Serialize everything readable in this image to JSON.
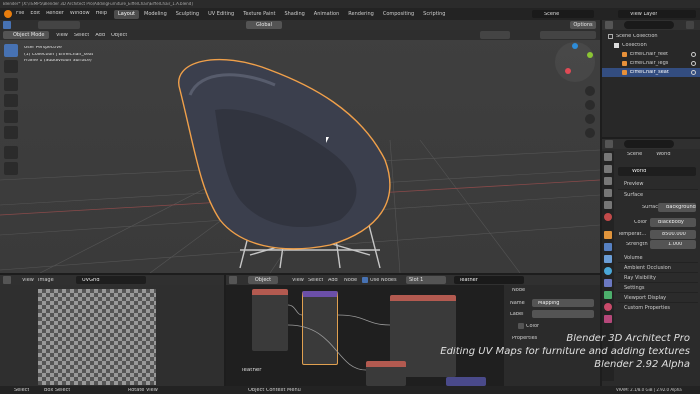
{
  "titlebar": {
    "title": "Blender* [X:\\TEMP5\\Blender 3D Architect Pro\\AddingFurniture_EiffelChair\\EiffelChair_1.A.blend]"
  },
  "menubar": {
    "menus": [
      "File",
      "Edit",
      "Render",
      "Window",
      "Help"
    ],
    "workspaces": [
      "Layout",
      "Modeling",
      "Sculpting",
      "UV Editing",
      "Texture Paint",
      "Shading",
      "Animation",
      "Rendering",
      "Compositing",
      "Scripting"
    ],
    "active_workspace": "Layout",
    "scene": "Scene",
    "view_layer": "View Layer"
  },
  "viewport": {
    "mode": "Object Mode",
    "menus": [
      "View",
      "Select",
      "Add",
      "Object"
    ],
    "transform": "Global",
    "options": "Options",
    "overlay_lines": [
      "User Perspective",
      "(1) Collection | EiffelChair_seat",
      "Frame 1 (Subdivision Surface)"
    ]
  },
  "outliner": {
    "root": "Scene Collection",
    "collection": "Collection",
    "items": [
      "EiffelChair_feet",
      "EiffelChair_legs",
      "EiffelChair_seat"
    ],
    "selected": "EiffelChair_seat"
  },
  "properties": {
    "context": "Scene",
    "tab": "World",
    "world_name": "World",
    "sections": [
      "Preview",
      "Surface",
      "Volume",
      "Ray Visibility",
      "Settings",
      "Custom Properties"
    ],
    "surface_label": "Surface",
    "surface_value": "Background",
    "color_label": "Color",
    "color_value": "Blackbody",
    "temp_label": "Temperat...",
    "temp_value": "8500.000",
    "strength_label": "Strength",
    "strength_value": "1.000",
    "ambient": "Ambient Occlusion"
  },
  "uv_editor": {
    "menus": [
      "View",
      "Image"
    ],
    "image": "UVGrid"
  },
  "node_editor": {
    "object": "Object",
    "menus": [
      "View",
      "Select",
      "Add",
      "Node"
    ],
    "use_nodes": "Use Nodes",
    "slot": "Slot 1",
    "material": "leather",
    "material_label": "leather"
  },
  "node_panel": {
    "header": "Node",
    "name_label": "Name",
    "name_value": "Mapping",
    "label_label": "Label",
    "color": "Color",
    "properties": "Properties"
  },
  "watermark": {
    "line1": "Blender 3D Architect Pro",
    "line2": "Editing UV Maps for furniture and adding textures",
    "line3": "Blender 2.92 Alpha"
  },
  "statusbar": {
    "items": [
      "Select",
      "Box Select",
      "Rotate View",
      "Object Context Menu"
    ],
    "right": "VRAM: 2.1/8.0 GiB | 2.92.0 Alpha"
  },
  "colors": {
    "accent": "#4772b3",
    "header": "#303030",
    "viewport_bg": "#3d3d3d"
  }
}
